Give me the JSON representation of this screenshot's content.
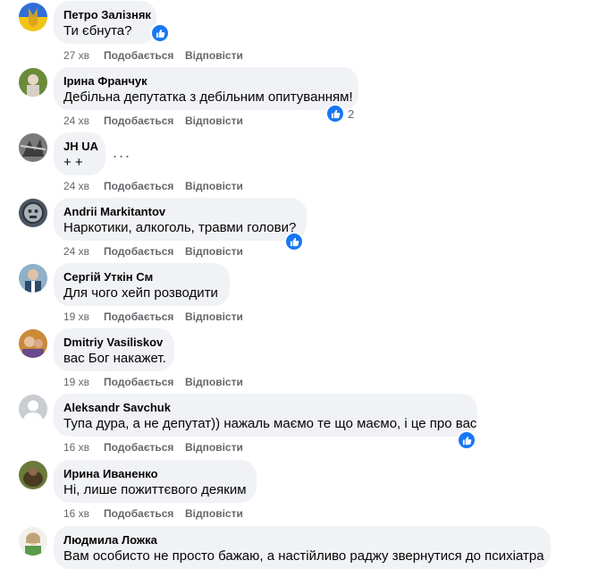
{
  "comments": [
    {
      "author": "Петро Залізняк",
      "text": "Ти єбнута?",
      "time": "27 хв",
      "like_label": "Подобається",
      "reply_label": "Відповісти",
      "reaction_count": ""
    },
    {
      "author": "Ірина Франчук",
      "text": "Дебільна депутатка з дебільним опитуванням!",
      "time": "24 хв",
      "like_label": "Подобається",
      "reply_label": "Відповісти",
      "reaction_count": "2"
    },
    {
      "author": "JH UA",
      "text": "+ +",
      "time": "24 хв",
      "like_label": "Подобається",
      "reply_label": "Відповісти",
      "reaction_count": ""
    },
    {
      "author": "Andrii Markitantov",
      "text": "Наркотики, алкоголь, травми голови?",
      "time": "24 хв",
      "like_label": "Подобається",
      "reply_label": "Відповісти",
      "reaction_count": ""
    },
    {
      "author": "Сергій Уткін См",
      "text": "Для чого хейп розводити",
      "time": "19 хв",
      "like_label": "Подобається",
      "reply_label": "Відповісти",
      "reaction_count": ""
    },
    {
      "author": "Dmitriy Vasiliskov",
      "text": "вас Бог накажет.",
      "time": "19 хв",
      "like_label": "Подобається",
      "reply_label": "Відповісти",
      "reaction_count": ""
    },
    {
      "author": "Aleksandr Savchuk",
      "text": "Тупа дура, а не депутат)) нажаль маємо те що маємо, і це про вас",
      "time": "16 хв",
      "like_label": "Подобається",
      "reply_label": "Відповісти",
      "reaction_count": ""
    },
    {
      "author": "Ирина Иваненко",
      "text": "Ні, лише пожиттєвого деяким",
      "time": "16 хв",
      "like_label": "Подобається",
      "reply_label": "Відповісти",
      "reaction_count": ""
    },
    {
      "author": "Людмила Ложка",
      "text": "Вам особисто не просто бажаю, а настійливо раджу звернутися до психіатра",
      "time": "",
      "like_label": "",
      "reply_label": "",
      "reaction_count": ""
    }
  ],
  "more_options_glyph": "···",
  "colors": {
    "bubble": "#f0f2f5",
    "secondary_text": "#65676b",
    "like_blue": "#1877f2"
  },
  "icons": {
    "reaction": "like-thumb-icon",
    "more": "more-options-icon",
    "default_avatar": "default-avatar-icon"
  }
}
